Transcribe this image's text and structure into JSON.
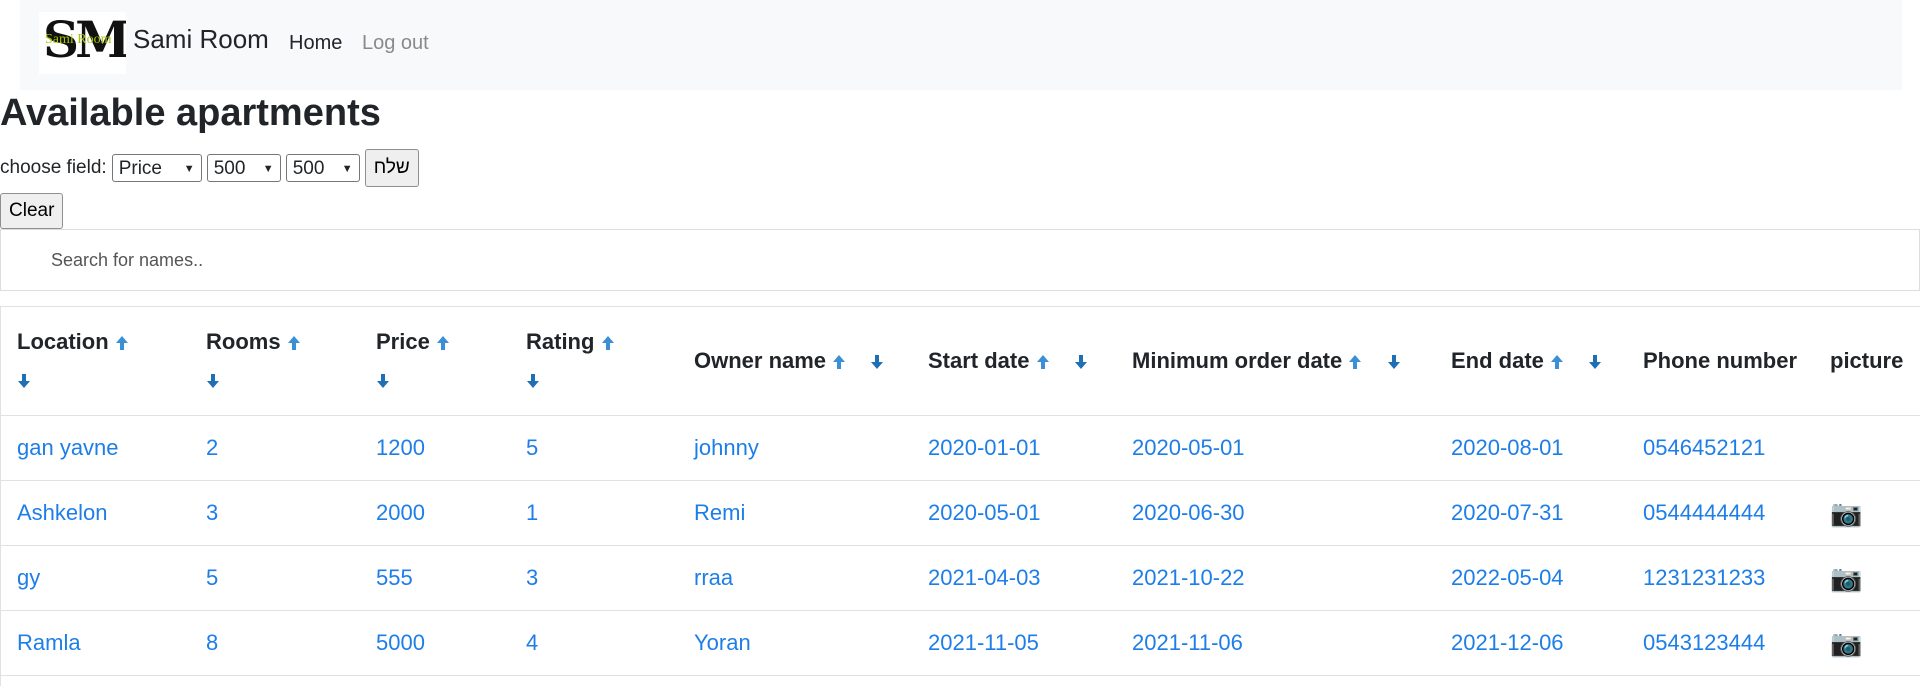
{
  "navbar": {
    "logo_text": "SM",
    "logo_subtext": "Sami Room",
    "brand": "Sami Room",
    "links": [
      "Home",
      "Log out"
    ]
  },
  "page_title": "Available apartments",
  "filter": {
    "label": "choose field:",
    "field_value": "Price",
    "min_value": "500",
    "max_value": "500",
    "send_label": "שלח",
    "clear_label": "Clear"
  },
  "search": {
    "placeholder": "Search for names.."
  },
  "table": {
    "headers": [
      "Location",
      "Rooms",
      "Price",
      "Rating",
      "Owner name",
      "Start date",
      "Minimum order date",
      "End date",
      "Phone number",
      "picture"
    ],
    "rows": [
      {
        "location": "gan yavne",
        "rooms": "2",
        "price": "1200",
        "rating": "5",
        "owner": "johnny",
        "start": "2020-01-01",
        "min_order": "2020-05-01",
        "end": "2020-08-01",
        "phone": "0546452121",
        "picture": ""
      },
      {
        "location": "Ashkelon",
        "rooms": "3",
        "price": "2000",
        "rating": "1",
        "owner": "Remi",
        "start": "2020-05-01",
        "min_order": "2020-06-30",
        "end": "2020-07-31",
        "phone": "0544444444",
        "picture": "📷"
      },
      {
        "location": "gy",
        "rooms": "5",
        "price": "555",
        "rating": "3",
        "owner": "rraa",
        "start": "2021-04-03",
        "min_order": "2021-10-22",
        "end": "2022-05-04",
        "phone": "1231231233",
        "picture": "📷"
      },
      {
        "location": "Ramla",
        "rooms": "8",
        "price": "5000",
        "rating": "4",
        "owner": "Yoran",
        "start": "2021-11-05",
        "min_order": "2021-11-06",
        "end": "2021-12-06",
        "phone": "0543123444",
        "picture": "📷"
      }
    ]
  },
  "colors": {
    "link": "#1e7ee8",
    "navbar_bg": "#f8f9fa",
    "sort_arrow": "#3a8fd6"
  },
  "icons": {
    "sort_up": "sort-up-icon",
    "sort_down": "sort-down-icon",
    "camera": "camera-icon"
  }
}
